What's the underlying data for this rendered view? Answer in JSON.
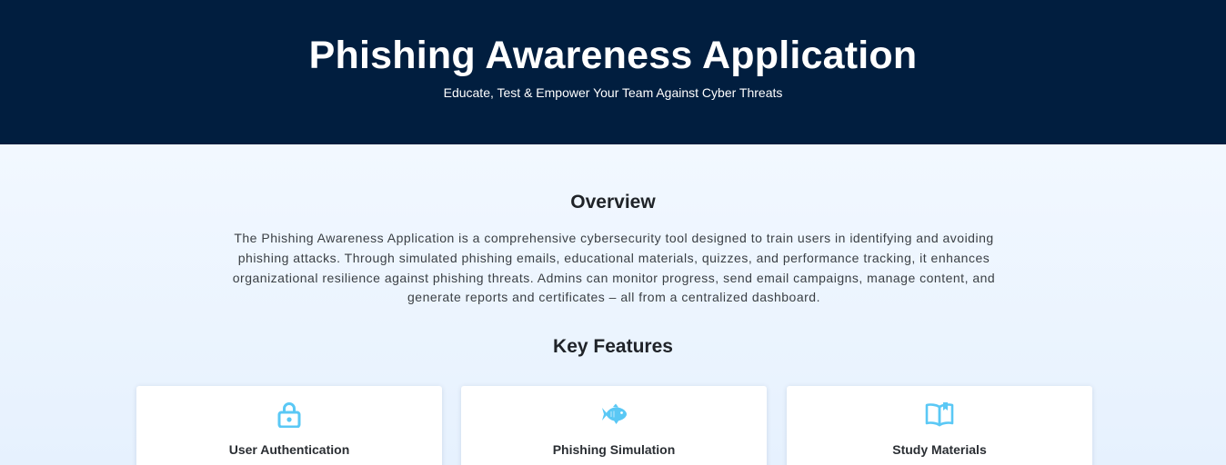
{
  "header": {
    "title": "Phishing Awareness Application",
    "subtitle": "Educate, Test & Empower Your Team Against Cyber Threats"
  },
  "overview": {
    "heading": "Overview",
    "text": "The Phishing Awareness Application is a comprehensive cybersecurity tool designed to train users in identifying and avoiding phishing attacks. Through simulated phishing emails, educational materials, quizzes, and performance tracking, it enhances organizational resilience against phishing threats. Admins can monitor progress, send email campaigns, manage content, and generate reports and certificates – all from a centralized dashboard."
  },
  "features": {
    "heading": "Key Features",
    "cards": [
      {
        "title": "User Authentication",
        "icon": "lock-icon"
      },
      {
        "title": "Phishing Simulation",
        "icon": "fish-icon"
      },
      {
        "title": "Study Materials",
        "icon": "book-open-icon"
      }
    ]
  },
  "colors": {
    "header_bg": "#011e3f",
    "accent_icon": "#5ac8f5",
    "page_bg": "#eef5fd"
  }
}
